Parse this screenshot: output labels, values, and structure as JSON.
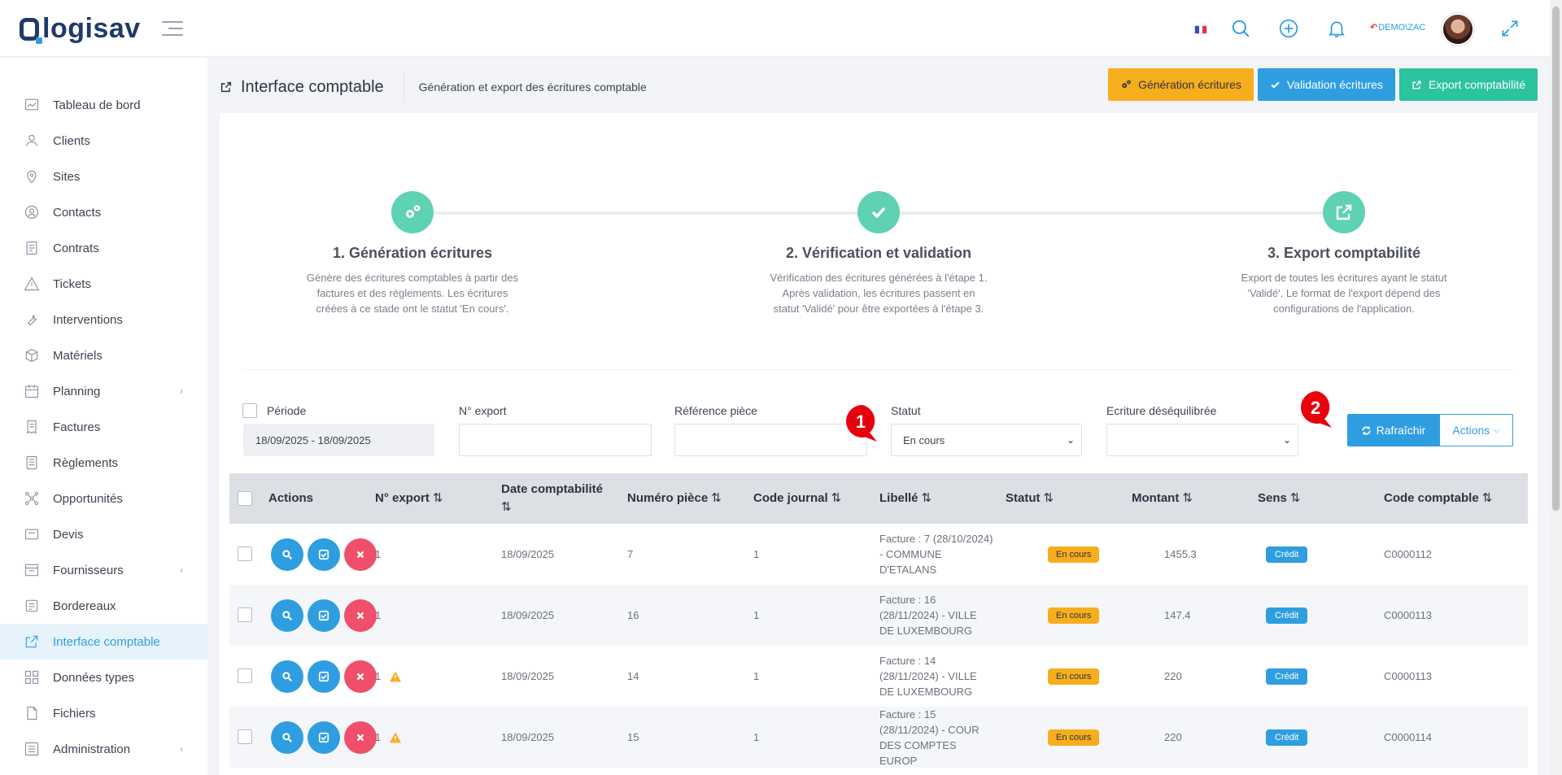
{
  "app": {
    "logo_text": "logisav",
    "user_link": "DEMO\\ZAC",
    "accent": "#2f9ee0",
    "flag": "France"
  },
  "sidebar": {
    "items": [
      {
        "label": "Tableau de bord",
        "icon": "dashboard-icon"
      },
      {
        "label": "Clients",
        "icon": "user-icon"
      },
      {
        "label": "Sites",
        "icon": "location-icon"
      },
      {
        "label": "Contacts",
        "icon": "contact-icon"
      },
      {
        "label": "Contrats",
        "icon": "contract-icon"
      },
      {
        "label": "Tickets",
        "icon": "warning-icon"
      },
      {
        "label": "Interventions",
        "icon": "wrench-icon"
      },
      {
        "label": "Matériels",
        "icon": "box-icon"
      },
      {
        "label": "Planning",
        "icon": "calendar-icon",
        "submenu": true
      },
      {
        "label": "Factures",
        "icon": "invoice-icon"
      },
      {
        "label": "Règlements",
        "icon": "payment-icon"
      },
      {
        "label": "Opportunités",
        "icon": "network-icon"
      },
      {
        "label": "Devis",
        "icon": "quote-icon"
      },
      {
        "label": "Fournisseurs",
        "icon": "truck-icon",
        "submenu": true
      },
      {
        "label": "Bordereaux",
        "icon": "slip-icon"
      },
      {
        "label": "Interface comptable",
        "icon": "external-link-icon",
        "active": true
      },
      {
        "label": "Données types",
        "icon": "grid-icon"
      },
      {
        "label": "Fichiers",
        "icon": "file-icon"
      },
      {
        "label": "Administration",
        "icon": "settings-icon",
        "submenu": true
      }
    ]
  },
  "page": {
    "title": "Interface comptable",
    "subtitle": "Génération et export des écritures comptable",
    "buttons": {
      "generation": "Génération écritures",
      "validation": "Validation écritures",
      "export": "Export comptabilité"
    }
  },
  "steps": [
    {
      "title": "1. Génération écritures",
      "text": "Génère des écritures comptables à partir des factures et des règlements. Les écritures créées à ce stade ont le statut 'En cours'."
    },
    {
      "title": "2. Vérification et validation",
      "text": "Vérification des écritures générées à l'étape 1. Après validation, les écritures passent en statut 'Validé' pour être exportées à l'étape 3."
    },
    {
      "title": "3. Export comptabilité",
      "text": "Export de toutes les écritures ayant le statut 'Validé'. Le format de l'export dépend des configurations de l'application."
    }
  ],
  "filters": {
    "periode_label": "Période",
    "periode_value": "18/09/2025 - 18/09/2025",
    "export_label": "N° export",
    "export_value": "",
    "reference_label": "Référence pièce",
    "reference_value": "",
    "statut_label": "Statut",
    "statut_value": "En cours",
    "desequilibre_label": "Ecriture déséquilibrée",
    "desequilibre_value": "",
    "refresh_label": "Rafraîchir",
    "actions_label": "Actions"
  },
  "annotations": [
    "1",
    "2"
  ],
  "table": {
    "columns": [
      "Actions",
      "N° export",
      "Date comptabilité",
      "Numéro pièce",
      "Code journal",
      "Libellé",
      "Statut",
      "Montant",
      "Sens",
      "Code comptable"
    ],
    "rows": [
      {
        "export": "1",
        "warning": false,
        "date": "18/09/2025",
        "piece": "7",
        "journal": "1",
        "libelle": "Facture : 7 (28/10/2024) - COMMUNE D'ETALANS",
        "statut": "En cours",
        "montant": "1455.3",
        "sens": "Crédit",
        "code": "C0000112"
      },
      {
        "export": "1",
        "warning": false,
        "date": "18/09/2025",
        "piece": "16",
        "journal": "1",
        "libelle": "Facture : 16 (28/11/2024) - VILLE DE LUXEMBOURG",
        "statut": "En cours",
        "montant": "147.4",
        "sens": "Crédit",
        "code": "C0000113"
      },
      {
        "export": "1",
        "warning": true,
        "date": "18/09/2025",
        "piece": "14",
        "journal": "1",
        "libelle": "Facture : 14 (28/11/2024) - VILLE DE LUXEMBOURG",
        "statut": "En cours",
        "montant": "220",
        "sens": "Crédit",
        "code": "C0000113"
      },
      {
        "export": "1",
        "warning": true,
        "date": "18/09/2025",
        "piece": "15",
        "journal": "1",
        "libelle": "Facture : 15 (28/11/2024) - COUR DES COMPTES EUROP",
        "statut": "En cours",
        "montant": "220",
        "sens": "Crédit",
        "code": "C0000114"
      }
    ]
  }
}
